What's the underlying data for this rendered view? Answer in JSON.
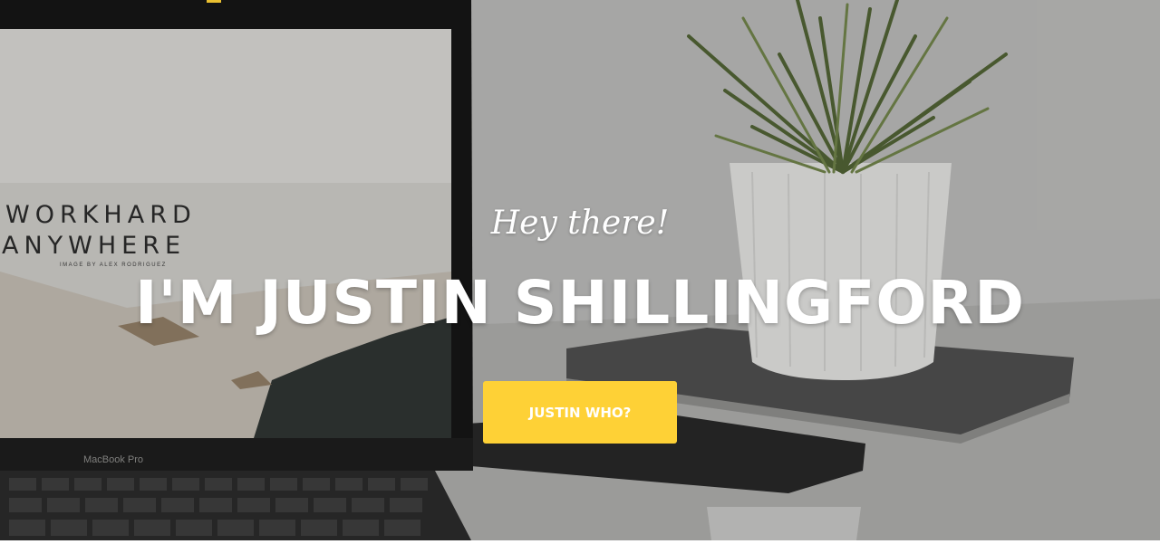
{
  "hero": {
    "background": {
      "laptop_screen_lines": [
        "WORKHARD",
        "ANYWHERE"
      ],
      "laptop_screen_credit": "IMAGE BY ALEX RODRIGUEZ",
      "laptop_brand": "MacBook Pro"
    },
    "greeting": "Hey there!",
    "headline": "I'M JUSTIN SHILLINGFORD",
    "cta_label": "JUSTIN WHO?"
  },
  "colors": {
    "accent": "#fed136",
    "text": "#ffffff"
  }
}
